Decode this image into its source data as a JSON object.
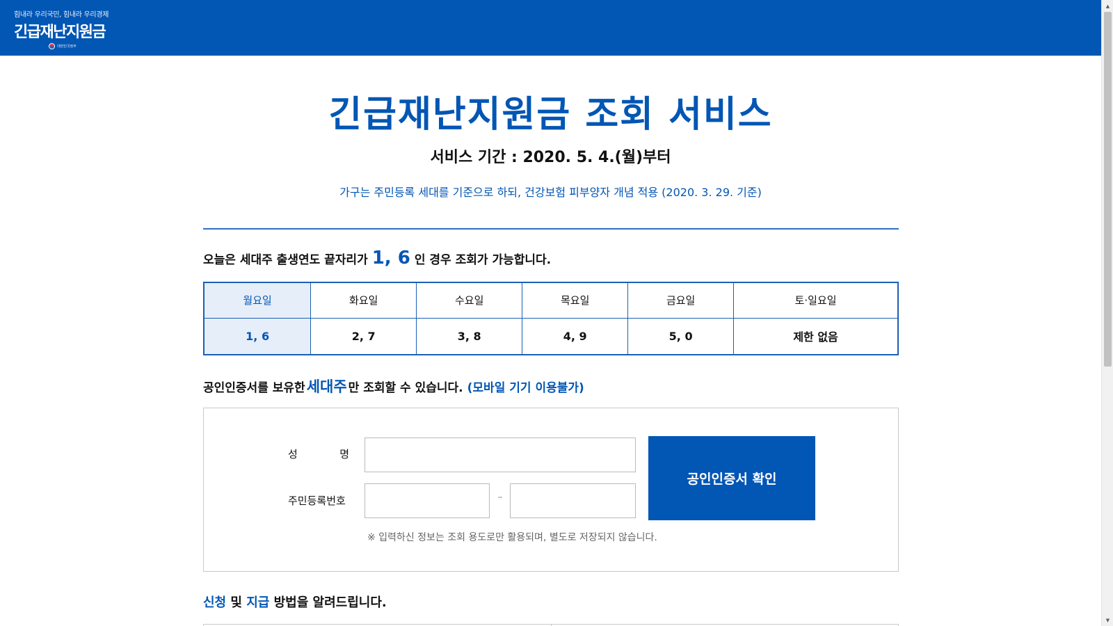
{
  "header": {
    "slogan": "힘내라 우리국민, 힘내라 우리경제",
    "logo_title": "긴급재난지원금",
    "gov_text": "대한민국정부",
    "background": "#0256b4"
  },
  "hero": {
    "title": "긴급재난지원금 조회 서비스",
    "period": "서비스 기간 : 2020. 5. 4.(월)부터",
    "notice": "가구는 주민등록 세대를 기준으로 하되, 건강보험 피부양자 개념 적용 (2020. 3. 29. 기준)"
  },
  "today": {
    "prefix": "오늘은 세대주 출생연도 끝자리가",
    "digits": "1, 6",
    "suffix": "인 경우 조회가 가능합니다."
  },
  "schedule": {
    "days": [
      "월요일",
      "화요일",
      "수요일",
      "목요일",
      "금요일",
      "토·일요일"
    ],
    "digits": [
      "1, 6",
      "2, 7",
      "3, 8",
      "4, 9",
      "5, 0",
      "제한 없음"
    ],
    "active_index": 0
  },
  "cert_notice": {
    "prefix": "공인인증서를 보유한",
    "highlight": "세대주",
    "suffix": "만 조회할 수 있습니다.",
    "mobile": "(모바일 기기 이용불가)"
  },
  "form": {
    "name_label_1": "성",
    "name_label_2": "명",
    "name_value": "",
    "rrn_label": "주민등록번호",
    "rrn_front_value": "",
    "rrn_back_value": "",
    "dash": "–",
    "submit_label": "공인인증서 확인",
    "privacy_note": "※ 입력하신 정보는 조회 용도로만 활용되며, 별도로 저장되지 않습니다."
  },
  "howto": {
    "word1": "신청",
    "mid1": " 및 ",
    "word2": "지급",
    "rest": " 방법을 알려드립니다."
  },
  "colors": {
    "accent": "#0256b4",
    "active_cell": "#e6eefa"
  }
}
